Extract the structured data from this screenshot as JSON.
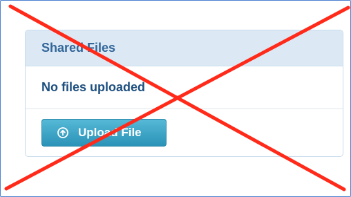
{
  "panel": {
    "title": "Shared Files",
    "empty_message": "No files uploaded",
    "upload_button_label": "Upload File",
    "upload_icon": "upload-circle-icon"
  },
  "overlay": {
    "type": "red-cross-out",
    "color": "#ff2a1a"
  }
}
